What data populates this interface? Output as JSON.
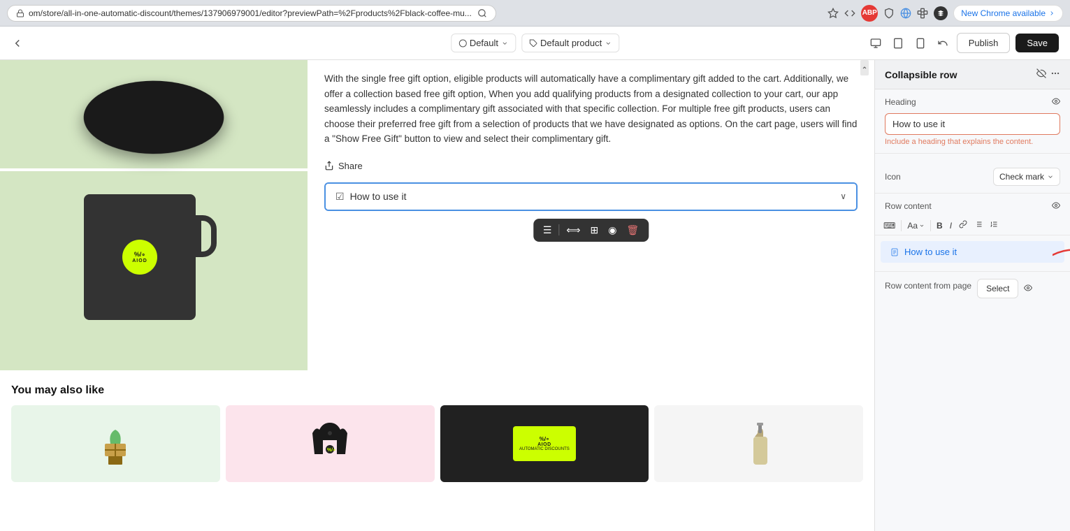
{
  "browser": {
    "address": "om/store/all-in-one-automatic-discount/themes/137906979001/editor?previewPath=%2Fproducts%2Fblack-coffee-mu...",
    "new_chrome_label": "New Chrome available"
  },
  "topbar": {
    "default_label": "Default",
    "default_product_label": "Default product",
    "publish_label": "Publish",
    "save_label": "Save"
  },
  "product": {
    "description": "With the single free gift option, eligible products will automatically have a complimentary gift added to the cart. Additionally, we offer a collection based free gift option, When you add qualifying products from a designated collection to your cart, our app seamlessly includes a complimentary gift associated with that specific collection. For multiple free gift products, users can choose their preferred free gift from a selection of products that we have designated as options. On the cart page, users will find a \"Show Free Gift\" button to view and select their complimentary gift.",
    "share_label": "Share",
    "collapsible_label": "How to use it",
    "you_may_also_like": "You may also like"
  },
  "right_panel": {
    "title": "Collapsible row",
    "heading_label": "Heading",
    "heading_value": "How to use it",
    "heading_helper": "Include a heading that explains the content.",
    "icon_label": "Icon",
    "icon_value": "Check mark",
    "row_content_label": "Row content",
    "row_content_item": "How to use it",
    "row_content_from_page": "Row content from page",
    "select_label": "Select"
  },
  "toolbar": {
    "icons": [
      "≡",
      "≡",
      "⊞",
      "○",
      "🗑"
    ]
  }
}
